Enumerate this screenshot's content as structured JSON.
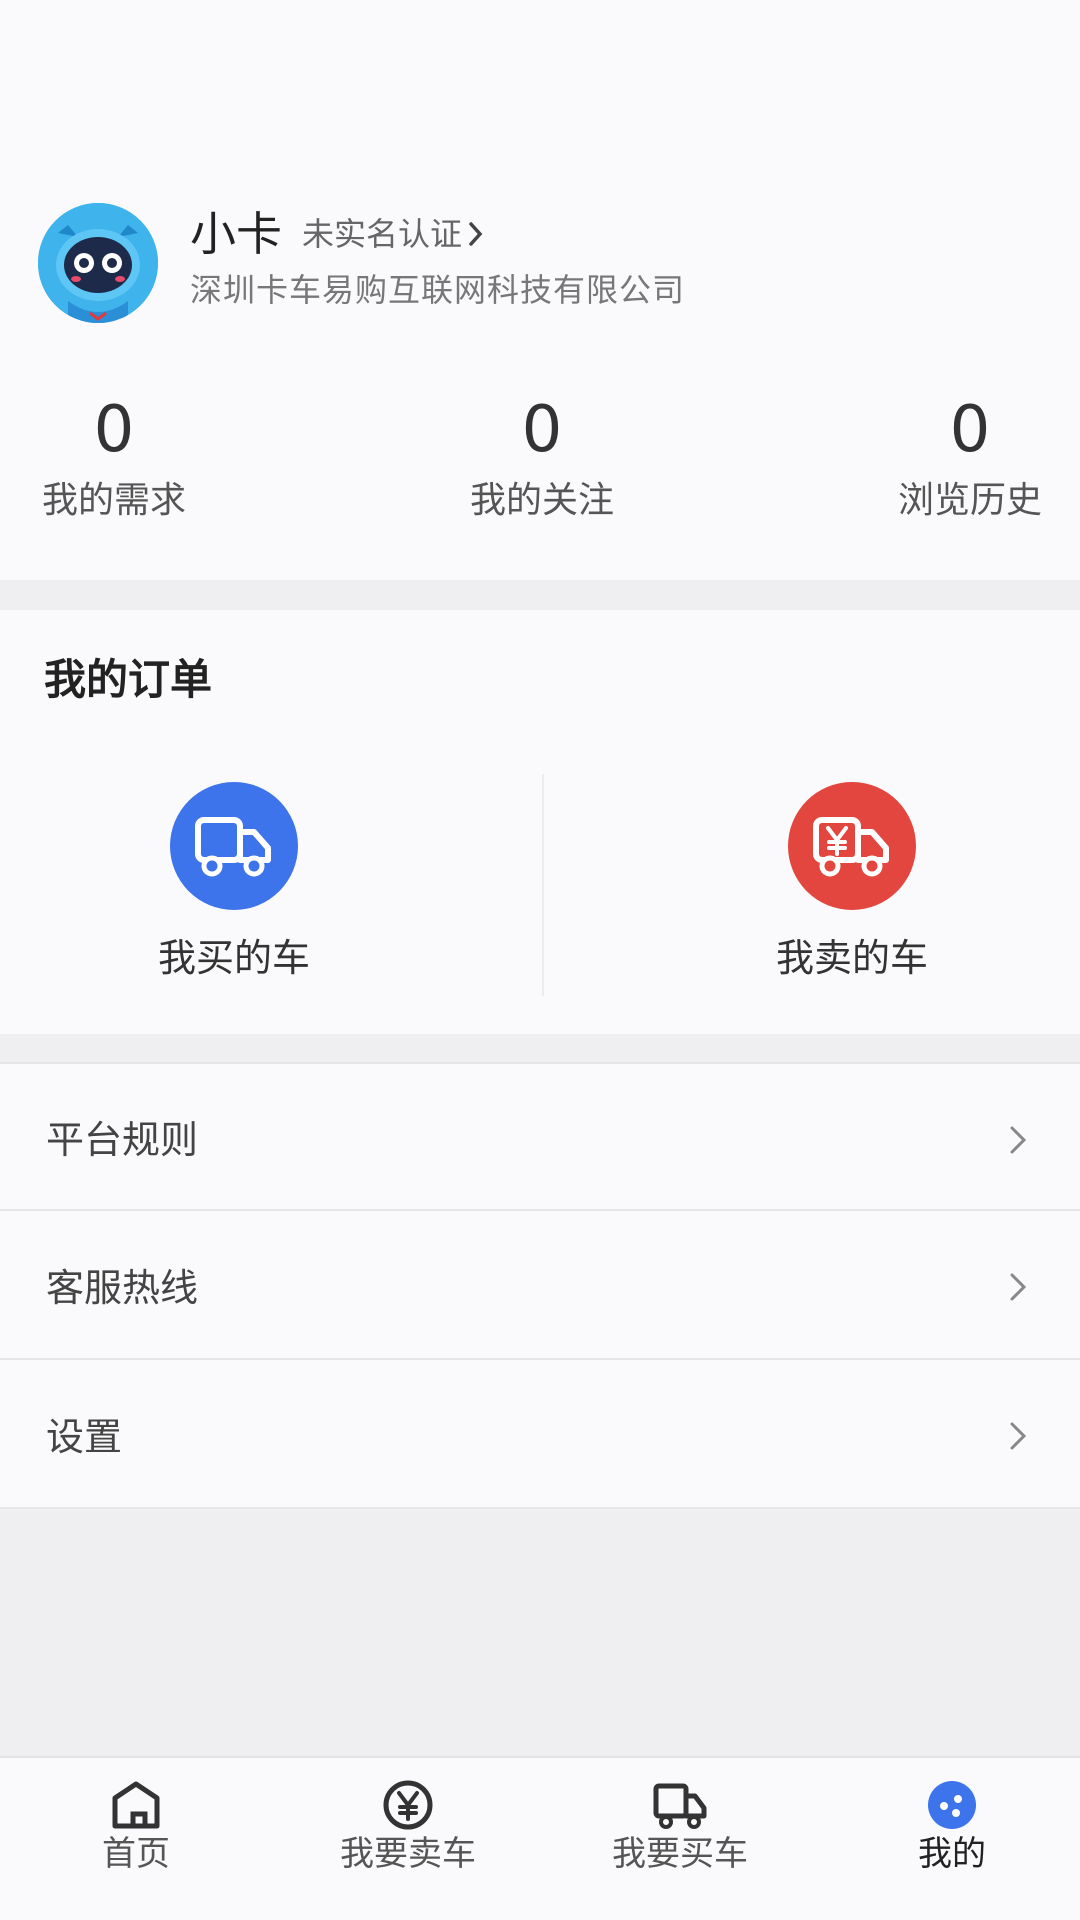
{
  "profile": {
    "name": "小卡",
    "verify_label": "未实名认证",
    "company": "深圳卡车易购互联网科技有限公司",
    "stats": [
      {
        "value": "0",
        "label": "我的需求"
      },
      {
        "value": "0",
        "label": "我的关注"
      },
      {
        "value": "0",
        "label": "浏览历史"
      }
    ]
  },
  "orders": {
    "title": "我的订单",
    "items": [
      {
        "label": "我买的车",
        "icon": "truck-icon",
        "color": "#3d73eb"
      },
      {
        "label": "我卖的车",
        "icon": "yen-truck-icon",
        "color": "#e2463e"
      }
    ]
  },
  "menu": {
    "items": [
      {
        "label": "平台规则"
      },
      {
        "label": "客服热线"
      },
      {
        "label": "设置"
      }
    ]
  },
  "tabbar": {
    "tabs": [
      {
        "label": "首页",
        "icon": "home-icon"
      },
      {
        "label": "我要卖车",
        "icon": "yen-icon"
      },
      {
        "label": "我要买车",
        "icon": "truck-icon"
      },
      {
        "label": "我的",
        "icon": "profile-icon",
        "active": true
      }
    ],
    "accent": "#3d73eb"
  }
}
